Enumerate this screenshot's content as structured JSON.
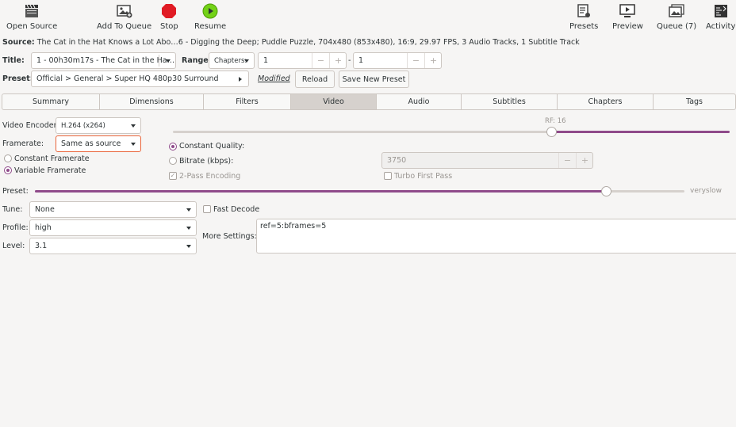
{
  "toolbar": {
    "open_source": "Open Source",
    "add_to_queue": "Add To Queue",
    "stop": "Stop",
    "resume": "Resume",
    "presets": "Presets",
    "preview": "Preview",
    "queue": "Queue (7)",
    "activity": "Activity"
  },
  "source": {
    "label": "Source:",
    "value": "The Cat in the Hat Knows a Lot Abo…6 - Digging the Deep; Puddle Puzzle, 704x480 (853x480), 16:9, 29.97 FPS, 3 Audio Tracks, 1 Subtitle Track"
  },
  "title_row": {
    "title_label": "Title:",
    "title_value": "1 - 00h30m17s - The Cat in the Ha…",
    "range_label": "Range:",
    "range_mode": "Chapters:",
    "range_start": "1",
    "range_dash": "-",
    "range_end": "1",
    "spin_minus": "−",
    "spin_plus": "+"
  },
  "preset_row": {
    "label": "Preset:",
    "value": "Official > General > Super HQ 480p30 Surround",
    "modified": "Modified",
    "reload": "Reload",
    "save_new": "Save New Preset"
  },
  "tabs": [
    {
      "label": "Summary"
    },
    {
      "label": "Dimensions"
    },
    {
      "label": "Filters"
    },
    {
      "label": "Video"
    },
    {
      "label": "Audio"
    },
    {
      "label": "Subtitles"
    },
    {
      "label": "Chapters"
    },
    {
      "label": "Tags"
    }
  ],
  "video": {
    "encoder_label": "Video Encoder:",
    "encoder_value": "H.264 (x264)",
    "framerate_label": "Framerate:",
    "framerate_value": "Same as source",
    "constant_framerate": "Constant Framerate",
    "variable_framerate": "Variable Framerate",
    "rf_label": "RF: 16",
    "rf_fraction": 0.68,
    "constant_quality": "Constant Quality:",
    "bitrate_label": "Bitrate (kbps):",
    "bitrate_value": "3750",
    "two_pass": "2-Pass Encoding",
    "turbo": "Turbo First Pass",
    "check_mark": "✓",
    "preset_label": "Preset:",
    "preset_fraction": 0.88,
    "preset_value": "veryslow",
    "tune_label": "Tune:",
    "tune_value": "None",
    "fast_decode": "Fast Decode",
    "profile_label": "Profile:",
    "profile_value": "high",
    "level_label": "Level:",
    "level_value": "3.1",
    "more_settings_label": "More Settings:",
    "more_settings_value": "ref=5:bframes=5"
  },
  "colors": {
    "accent": "#8f4a8a",
    "focus": "#e9643a",
    "stop_red": "#e01b24",
    "resume_green": "#4e9a06"
  }
}
